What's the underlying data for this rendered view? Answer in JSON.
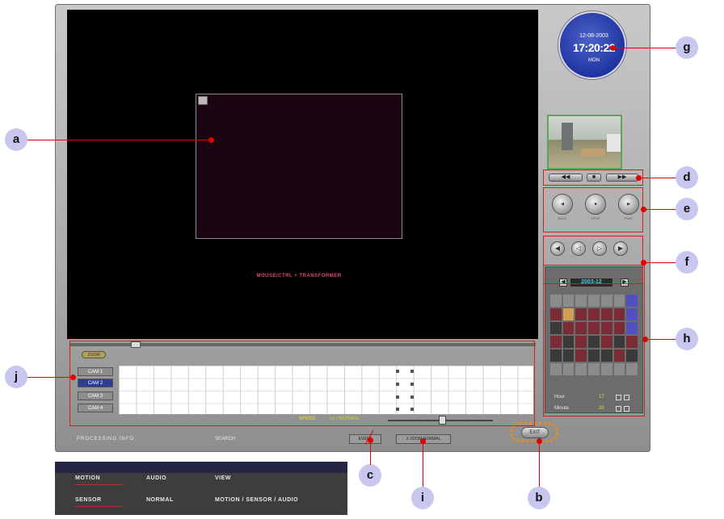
{
  "clock": {
    "date": "12-08-2003",
    "time": "17:20:22",
    "day": "MON"
  },
  "pip": {
    "caption": "MOUSE/CTRL + TRANSFORMER",
    "corner_icon": "pip-close-icon"
  },
  "channel_controls": {
    "prev": "◀◀",
    "mid": "■",
    "next": "▶▶"
  },
  "playback_buttons": [
    {
      "cap": "BACK"
    },
    {
      "cap": "STOP"
    },
    {
      "cap": "PLAY"
    }
  ],
  "nav_buttons": [
    "◀",
    "◁",
    "▷",
    "▶",
    "◀◀",
    "◁◁",
    "▷▷",
    "▶▶"
  ],
  "calendar": {
    "month": "2003-12",
    "hour_label": "Hour",
    "hour_value": "17",
    "minute_label": "Minute",
    "minute_value": "20"
  },
  "timeline": {
    "zoom_label": "ZOOM",
    "cameras": [
      "CAM 1",
      "CAM 2",
      "CAM 3",
      "CAM 4"
    ]
  },
  "speed": {
    "label": "SPEED",
    "value": "x1 / NORMAL"
  },
  "status": {
    "left": "PROCESSING INFO",
    "mid": "SEARCH"
  },
  "tabs": {
    "event": "EVENT",
    "zoom": "X ZOOM NORMAL"
  },
  "exit_label": "EXIT",
  "legend": {
    "row1": [
      "MOTION",
      "AUDIO",
      "VIEW"
    ],
    "row2": [
      "SENSOR",
      "NORMAL",
      "MOTION / SENSOR / AUDIO"
    ]
  },
  "callouts": {
    "a": "a",
    "b": "b",
    "c": "c",
    "d": "d",
    "e": "e",
    "f": "f",
    "g": "g",
    "h": "h",
    "i": "i",
    "j": "j"
  }
}
